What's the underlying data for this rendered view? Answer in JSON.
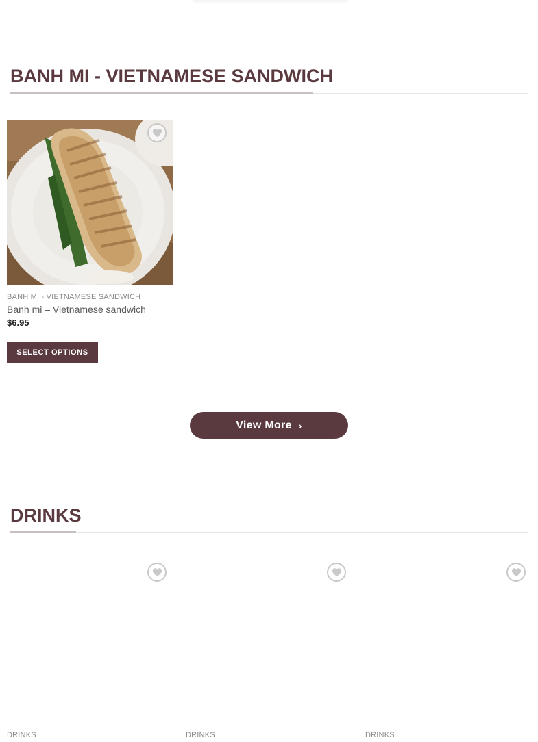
{
  "colors": {
    "brand": "#5a3a3f",
    "divider": "#e6e6e6",
    "wishlist_border": "#c9c9c9"
  },
  "sections": {
    "banh_mi": {
      "title": "BANH MI - VIETNAMESE SANDWICH",
      "products": [
        {
          "category": "BANH MI - VIETNAMESE SANDWICH",
          "name": "Banh mi – Vietnamese sandwich",
          "price": "$6.95",
          "button_label": "SELECT OPTIONS",
          "wishlist_icon": "heart-icon"
        }
      ]
    },
    "view_more": {
      "label": "View More",
      "icon": "chevron-right-icon"
    },
    "drinks": {
      "title": "DRINKS",
      "products": [
        {
          "category": "DRINKS",
          "wishlist_icon": "heart-icon"
        },
        {
          "category": "DRINKS",
          "wishlist_icon": "heart-icon"
        },
        {
          "category": "DRINKS",
          "wishlist_icon": "heart-icon"
        }
      ]
    }
  }
}
